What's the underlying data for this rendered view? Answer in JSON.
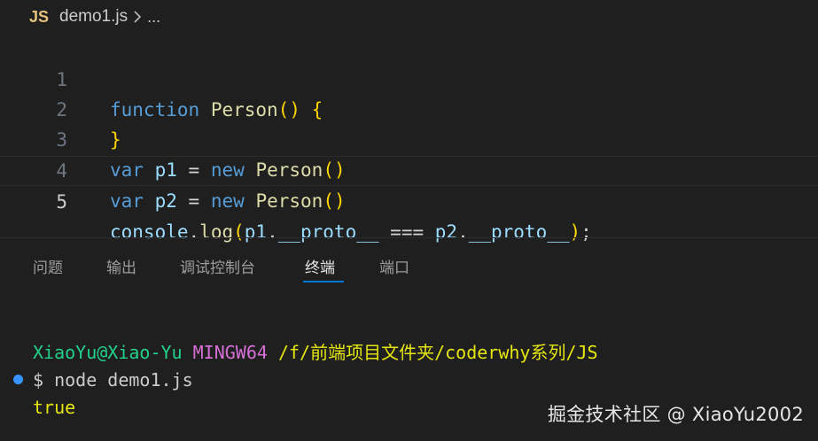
{
  "breadcrumb": {
    "lang_badge": "JS",
    "file": "demo1.js",
    "ellipsis": "..."
  },
  "editor": {
    "lines": [
      {
        "number": "1",
        "tokens": [
          "function",
          "Person",
          "()",
          "{"
        ]
      },
      {
        "number": "2",
        "tokens": [
          "}"
        ]
      },
      {
        "number": "3",
        "tokens": [
          "var",
          "p1",
          "=",
          "new",
          "Person",
          "()"
        ]
      },
      {
        "number": "4",
        "tokens": [
          "var",
          "p2",
          "=",
          "new",
          "Person",
          "()"
        ]
      },
      {
        "number": "5",
        "tokens": [
          "console",
          ".",
          "log",
          "(",
          "p1",
          ".",
          "__proto__",
          "===",
          "p2",
          ".",
          "__proto__",
          ")",
          ";"
        ]
      }
    ],
    "active_line": "5"
  },
  "panel": {
    "tabs": [
      "问题",
      "输出",
      "调试控制台",
      "终端",
      "端口"
    ],
    "active_tab": "终端"
  },
  "terminal": {
    "user_host": "XiaoYu@Xiao-Yu",
    "shell": "MINGW64",
    "path": "/f/前端项目文件夹/coderwhy系列/JS",
    "prompt": "$",
    "command": "node demo1.js",
    "output": "true"
  },
  "watermark": "掘金技术社区 @ XiaoYu2002",
  "colors": {
    "keyword": "#569cd6",
    "function": "#dcdcaa",
    "bracket": "#ffd700",
    "variable": "#9cdcfe",
    "terminal_green": "#23d18b",
    "terminal_magenta": "#d670d6",
    "terminal_yellow": "#e5e510",
    "accent": "#0078d4"
  }
}
